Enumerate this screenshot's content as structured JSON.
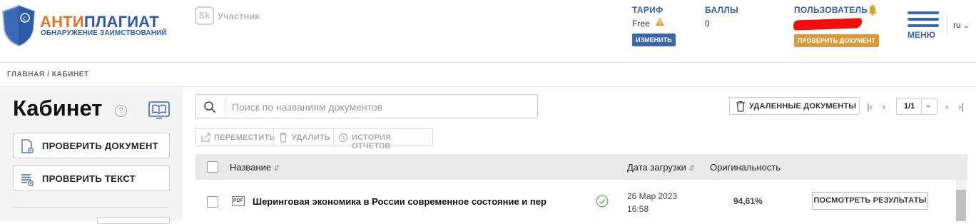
{
  "header": {
    "logo_title_a": "АНТИ",
    "logo_title_b": "ПЛАГИАТ",
    "logo_subtitle": "ОБНАРУЖЕНИЕ ЗАИМСТВОВАНИЙ",
    "partner_mark": "Sk",
    "partner_text": "Участник",
    "tariff_label": "ТАРИФ",
    "tariff_value": "Free",
    "tariff_button": "ИЗМЕНИТЬ",
    "points_label": "БАЛЛЫ",
    "points_value": "0",
    "user_label": "ПОЛЬЗОВАТЕЛЬ",
    "user_button": "ПРОВЕРИТЬ ДОКУМЕНТ",
    "menu_label": "МЕНЮ",
    "lang": "ru"
  },
  "breadcrumb": "ГЛАВНАЯ / КАБИНЕТ",
  "sidebar": {
    "title": "Кабинет",
    "help": "?",
    "check_document": "ПРОВЕРИТЬ ДОКУМЕНТ",
    "check_text": "ПРОВЕРИТЬ ТЕКСТ"
  },
  "search": {
    "placeholder": "Поиск по названиям документов"
  },
  "deleted_docs": "УДАЛЕННЫЕ ДОКУМЕНТЫ",
  "pager": {
    "value": "1/1"
  },
  "toolbar": {
    "move": "ПЕРЕМЕСТИТЬ",
    "delete": "УДАЛИТЬ",
    "history": "ИСТОРИЯ ОТЧЕТОВ"
  },
  "table": {
    "col_name": "Название",
    "col_date": "Дата загрузки",
    "col_orig": "Оригинальность",
    "rows": [
      {
        "type": "PDF",
        "name": "Шеринговая экономика в России современное состояние и пер",
        "date": "26 Мар 2023",
        "time": "16:58",
        "originality": "94,61%",
        "action": "ПОСМОТРЕТЬ РЕЗУЛЬТАТЫ"
      }
    ]
  },
  "colors": {
    "brand_blue": "#2d5aa8",
    "brand_orange": "#e2752a",
    "button_orange": "#d99a3b"
  }
}
